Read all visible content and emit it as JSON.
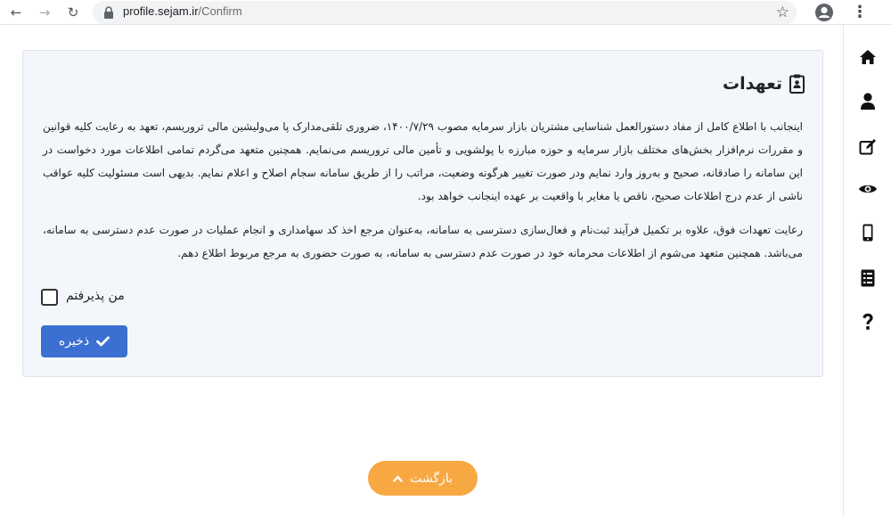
{
  "browser": {
    "url_host": "profile.sejam.ir",
    "url_path": "/Confirm"
  },
  "sidebar": {
    "items": [
      {
        "name": "home-icon"
      },
      {
        "name": "user-icon"
      },
      {
        "name": "edit-icon"
      },
      {
        "name": "eye-icon"
      },
      {
        "name": "mobile-icon"
      },
      {
        "name": "document-list-icon"
      },
      {
        "name": "question-icon"
      }
    ]
  },
  "card": {
    "title": "تعهدات",
    "paragraph1": "اینجانب با اطلاع کامل از مفاد دستورالعمل شناسایی مشتریان بازار سرمایه مصوب ۱۴۰۰/۷/۲۹، ضروری تلقی‌مدارک پا می‌ولیشین مالی تروریسم، تعهد به رعایت کلیه قوانین و مقررات نرم‌افزار بخش‌های مختلف بازار سرمایه و حوزه مبارزه با پولشویی و تأمین مالی تروریسم می‌نمایم. همچنین متعهد می‌گردم تمامی اطلاعات مورد دخواست در این سامانه را صادقانه، صحیح و به‌روز وارد نمایم ودر صورت تغییر هرگونه وضعیت، مراتب را از طریق سامانه سجام اصلاح و اعلام نمایم. بدیهی است مسئولیت کلیه عواقب ناشی از عدم درج اطلاعات صحیح، ناقص یا مغایر با واقعیت بر عهده اینجانب خواهد بود.",
    "paragraph2": "رعایت تعهدات فوق، علاوه بر تکمیل فرآیند ثبت‌نام و فعال‌سازی دسترسی به سامانه، به‌عنوان مرجع اخذ کد سهامداری و انجام عملیات در صورت عدم دسترسی به سامانه، می‌باشد. همچنین متعهد می‌شوم از اطلاعات محرمانه خود در صورت عدم دسترسی به سامانه، به صورت حضوری به مرجع مربوط اطلاع دهم.",
    "accept_label": "من پذیرفتم",
    "save_label": "ذخیره"
  },
  "footer": {
    "back_label": "بازگشت"
  },
  "colors": {
    "primary": "#3b6fd1",
    "accent": "#f7a842",
    "card_bg": "#f3f6fa"
  }
}
